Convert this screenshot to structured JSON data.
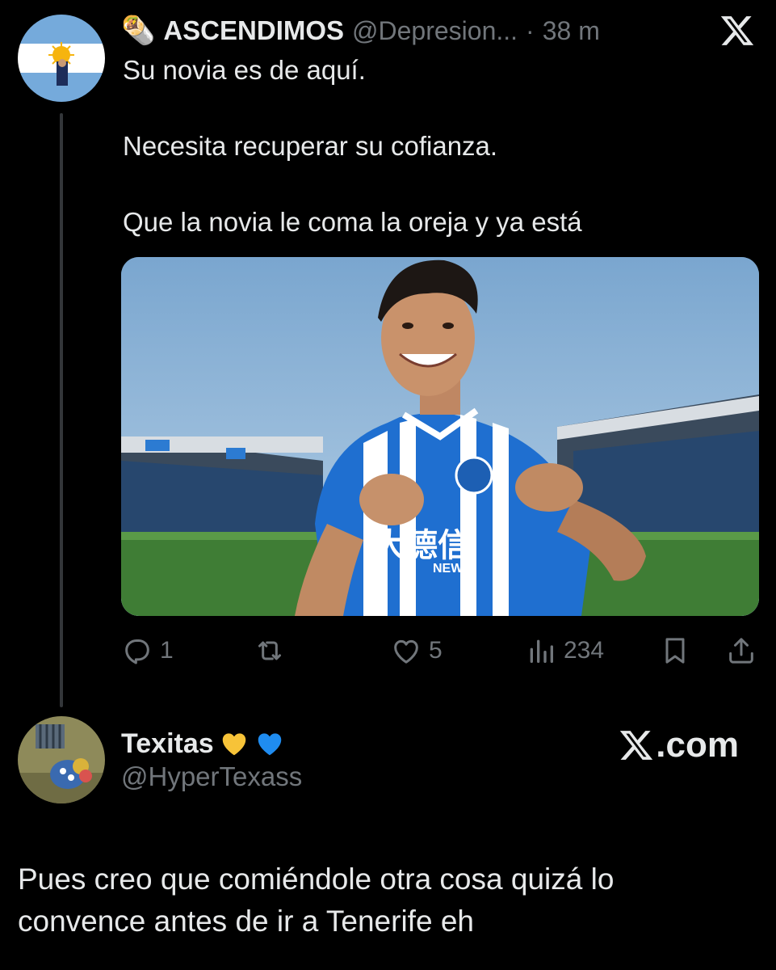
{
  "top_tweet": {
    "emoji": "🌯",
    "display_name": "ASCENDIMOS",
    "handle": "@Depresion...",
    "separator": "·",
    "time": "38 m",
    "paragraphs": [
      "Su novia es de aquí.",
      "Necesita recuperar su cofianza.",
      "Que la novia le coma la oreja y ya está"
    ],
    "media": {
      "shirt_sponsor": "大德信",
      "shirt_sponsor_sub": "NEWS"
    },
    "actions": {
      "replies": "1",
      "reposts": "",
      "likes": "5",
      "views": "234"
    }
  },
  "bottom_tweet": {
    "display_name": "Texitas",
    "hearts": [
      "yellow",
      "blue"
    ],
    "handle": "@HyperTexass",
    "text": "Pues creo que comiéndole otra cosa quizá lo convence antes de ir a Tenerife eh"
  },
  "branding": {
    "site": ".com"
  },
  "colors": {
    "background": "#000000",
    "text_primary": "#e7e9ea",
    "text_secondary": "#71767b",
    "thread_line": "#333639",
    "heart_yellow": "#f7c338",
    "heart_blue": "#1f8cf0"
  }
}
